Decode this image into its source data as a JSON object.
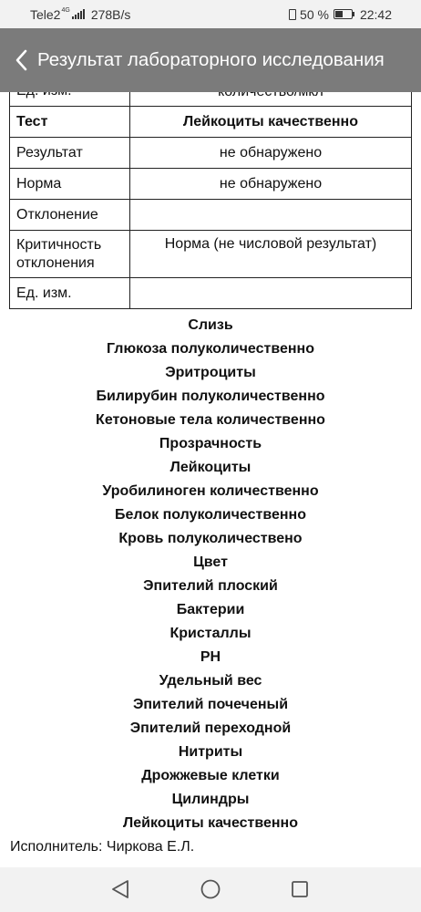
{
  "status_bar": {
    "carrier": "Tele2",
    "network_type": "4G",
    "speed": "278B/s",
    "battery": "50 %",
    "battery_level": 0.5,
    "time": "22:42"
  },
  "app_bar": {
    "title": "Результат лабораторного исследования"
  },
  "table": {
    "cut_row": {
      "value": "количество/мкл"
    },
    "rows": [
      {
        "label": "Тест",
        "value": "Лейкоциты качественно"
      },
      {
        "label": "Результат",
        "value": "не обнаружено"
      },
      {
        "label": "Норма",
        "value": "не обнаружено"
      },
      {
        "label": "Отклонение",
        "value": ""
      },
      {
        "label": "Критичность отклонения",
        "value": "Норма (не числовой результат)"
      },
      {
        "label": "Ед. изм.",
        "value": ""
      }
    ],
    "cut_row_label": "Ед. изм."
  },
  "test_list": [
    "Слизь",
    "Глюкоза полуколичественно",
    "Эритроциты",
    "Билирубин полуколичественно",
    "Кетоновые тела количественно",
    "Прозрачность",
    "Лейкоциты",
    "Уробилиноген количественно",
    "Белок полуколичественно",
    "Кровь полуколичествено",
    "Цвет",
    "Эпителий плоский",
    "Бактерии",
    "Кристаллы",
    "PH",
    "Удельный вес",
    "Эпителий почеченый",
    "Эпителий переходной",
    "Нитриты",
    "Дрожжевые клетки",
    "Цилиндры",
    "Лейкоциты качественно"
  ],
  "executor": "Исполнитель: Чиркова Е.Л.",
  "colors": {
    "app_bar_bg": "#7b7b7b",
    "status_bar_bg": "#f2f2f2",
    "nav_bar_bg": "#f2f2f2"
  },
  "nav_icons": [
    "back-triangle-icon",
    "home-circle-icon",
    "recents-square-icon"
  ]
}
